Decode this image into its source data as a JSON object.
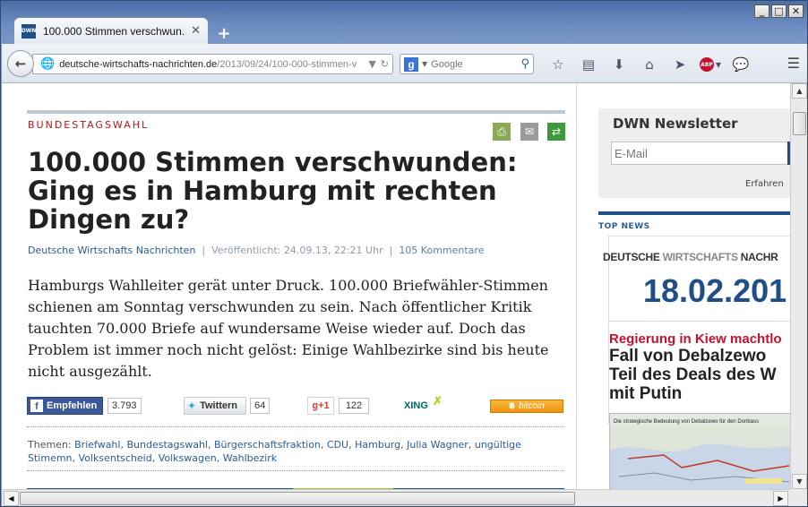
{
  "window": {
    "minimize": "_",
    "maximize": "□",
    "close": "✕"
  },
  "tab": {
    "favicon": "DWN",
    "title": "100.000 Stimmen verschwun...",
    "close": "✕",
    "new_tab": "+"
  },
  "navbar": {
    "url_host": "deutsche-wirtschafts-nachrichten.de",
    "url_path": "/2013/09/24/100-000-stimmen-v",
    "search_engine_icon": "g",
    "search_placeholder": "Google",
    "toolbar_icons": [
      "star-icon",
      "reading-list-icon",
      "download-icon",
      "home-icon",
      "send-icon",
      "adblock-icon",
      "chat-icon"
    ],
    "abp_label": "ABP"
  },
  "article": {
    "category": "BUNDESTAGSWAHL",
    "headline": "100.000 Stimmen verschwunden: Ging es in Hamburg mit rechten Dingen zu?",
    "author": "Deutsche Wirtschafts Nachrichten",
    "separator": "|",
    "published": "Veröffentlicht: 24.09.13, 22:21 Uhr",
    "comments": "105 Kommentare",
    "lead": "Hamburgs Wahlleiter gerät unter Druck. 100.000 Briefwähler-Stimmen schienen am Sonntag verschwunden zu sein. Nach öffentlicher Kritik tauchten 70.000 Briefe auf wundersame Weise wieder auf. Doch das Problem ist immer noch nicht gelöst: Einige Wahlbezirke sind bis heute nicht ausgezählt.",
    "social": {
      "facebook_label": "Empfehlen",
      "facebook_count": "3.793",
      "twitter_label": "Twittern",
      "twitter_count": "64",
      "gplus_label": "+1",
      "gplus_count": "122",
      "xing_label": "XING",
      "bitcoin_label": "bitcoin"
    },
    "tags_label": "Themen:",
    "tags": [
      "Briefwahl",
      "Bundestagswahl",
      "Bürgerschaftsfraktion",
      "CDU",
      "Hamburg",
      "Julia Wagner",
      "ungültige Stimemn",
      "Volksentscheid",
      "Volkswagen",
      "Wahlbezirk"
    ]
  },
  "sidebar": {
    "newsletter_title": "DWN Newsletter",
    "email_placeholder": "E-Mail",
    "more_link": "Erfahren",
    "top_news_label": "TOP NEWS",
    "brand_part1": "DEUTSCHE ",
    "brand_part2": "WIRTSCHAFTS ",
    "brand_part3": "NACHR",
    "date": "18.02.201",
    "kicker": "Regierung in Kiew machtlo",
    "headline": "Fall von Debalzewo\nTeil des Deals des W\nmit Putin",
    "map_title": "Die strategische Bedeutung von Debalzewo für den Donbass"
  },
  "colors": {
    "accent_blue": "#1f4f86",
    "category_red": "#b8161b",
    "link_blue": "#2b5b96",
    "print_green": "#8aab55",
    "mail_gray": "#9a9a9a",
    "more_green": "#3a9a3c"
  }
}
